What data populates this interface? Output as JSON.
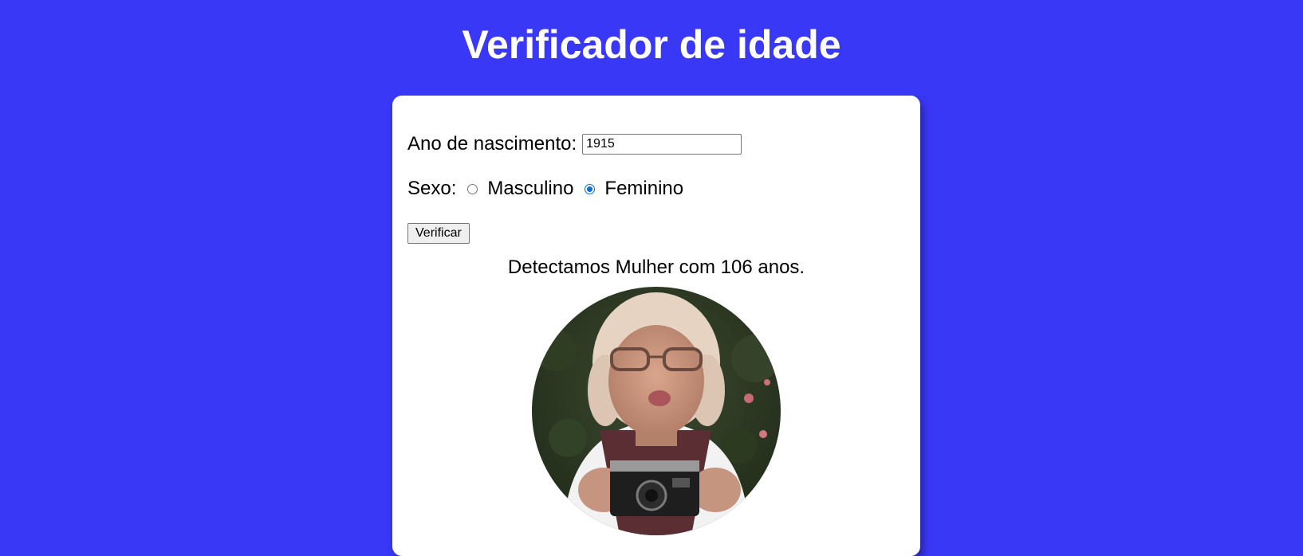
{
  "page": {
    "title": "Verificador de idade",
    "background_color": "#3a38f7"
  },
  "form": {
    "year_label": "Ano de nascimento:",
    "year_value": "1915",
    "sex_label": "Sexo:",
    "sex_options": [
      {
        "label": "Masculino",
        "checked": false
      },
      {
        "label": "Feminino",
        "checked": true
      }
    ],
    "submit_label": "Verificar"
  },
  "result": {
    "text": "Detectamos Mulher com 106 anos.",
    "image": "elderly-woman-with-camera-photo"
  }
}
